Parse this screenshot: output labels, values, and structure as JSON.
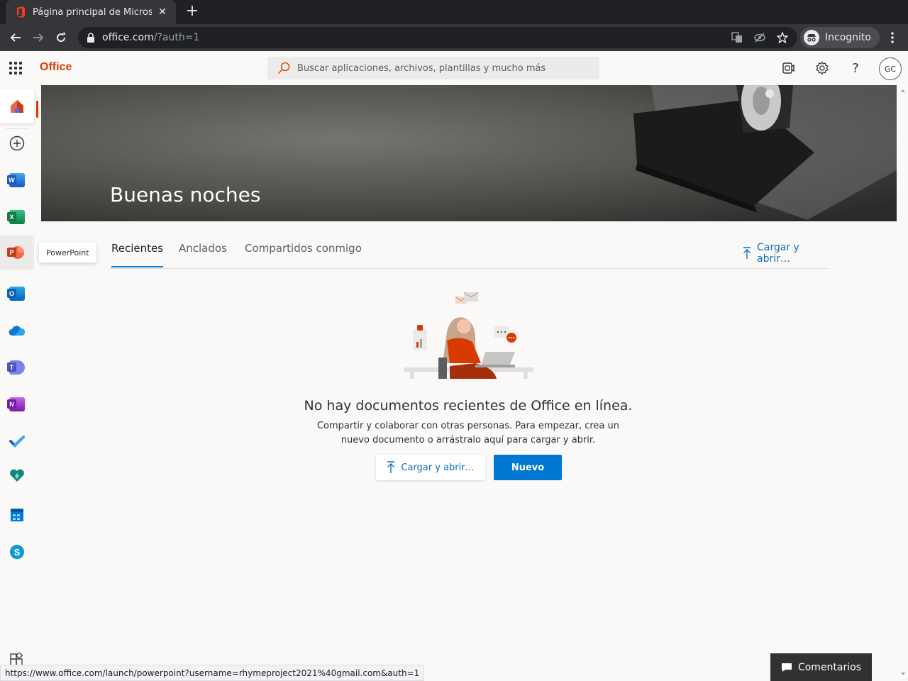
{
  "browser": {
    "tab_title": "Página principal de Microsoft Office",
    "url_host": "office.com",
    "url_path": "/?auth=1",
    "incognito_label": "Incognito",
    "status_url": "https://www.office.com/launch/powerpoint?username=rhymeproject2021%40gmail.com&auth=1"
  },
  "header": {
    "brand": "Office",
    "search_placeholder": "Buscar aplicaciones, archivos, plantillas y mucho más",
    "avatar_initials": "GC"
  },
  "rail": {
    "items": [
      {
        "name": "home",
        "icon": "home-icon"
      },
      {
        "name": "create",
        "icon": "add-circle-icon"
      },
      {
        "name": "word",
        "icon": "word-icon",
        "letter": "W",
        "color": "#185abd"
      },
      {
        "name": "excel",
        "icon": "excel-icon",
        "letter": "X",
        "color": "#107c41"
      },
      {
        "name": "powerpoint",
        "icon": "powerpoint-icon",
        "letter": "P",
        "color": "#c43e1c"
      },
      {
        "name": "outlook",
        "icon": "outlook-icon",
        "letter": "O",
        "color": "#0a64b5"
      },
      {
        "name": "onedrive",
        "icon": "onedrive-icon",
        "color": "#0f78d4"
      },
      {
        "name": "teams",
        "icon": "teams-icon",
        "letter": "T",
        "color": "#4b53bc"
      },
      {
        "name": "onenote",
        "icon": "onenote-icon",
        "letter": "N",
        "color": "#7719aa"
      },
      {
        "name": "todo",
        "icon": "todo-icon",
        "color": "#2564cf"
      },
      {
        "name": "family-safety",
        "icon": "family-safety-icon",
        "color": "#0e8a7d"
      },
      {
        "name": "calendar",
        "icon": "calendar-icon",
        "color": "#0078d4"
      },
      {
        "name": "skype",
        "icon": "skype-icon",
        "letter": "S",
        "color": "#0a9bd6"
      }
    ],
    "tooltip": "PowerPoint"
  },
  "hero": {
    "greeting": "Buenas noches"
  },
  "tabs": [
    {
      "label": "Recientes",
      "active": true
    },
    {
      "label": "Anclados",
      "active": false
    },
    {
      "label": "Compartidos conmigo",
      "active": false
    }
  ],
  "upload_label": "Cargar y abrir…",
  "empty_state": {
    "title": "No hay documentos recientes de Office en línea.",
    "description": "Compartir y colaborar con otras personas. Para empezar, crea un nuevo documento o arrástralo aquí para cargar y abrir.",
    "upload_button": "Cargar y abrir…",
    "new_button": "Nuevo"
  },
  "feedback_label": "Comentarios",
  "colors": {
    "brand": "#d83b01",
    "accent": "#0078d4"
  }
}
